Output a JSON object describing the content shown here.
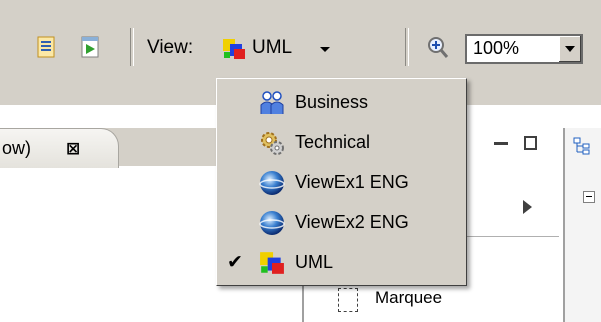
{
  "toolbar": {
    "view_label": "View:",
    "current_view": "UML",
    "zoom_value": "100%",
    "icons": [
      "report-icon",
      "run-icon",
      "uml-icon",
      "zoom-in-icon"
    ]
  },
  "editor": {
    "tab_label": "ow)",
    "tab_close_glyph": "⊠",
    "palette": {
      "marquee_label": "Marquee"
    }
  },
  "view_menu": {
    "items": [
      {
        "label": "Business",
        "icon": "business-people-icon",
        "checked": false
      },
      {
        "label": "Technical",
        "icon": "gears-icon",
        "checked": false
      },
      {
        "label": "ViewEx1 ENG",
        "icon": "sphere-icon",
        "checked": false
      },
      {
        "label": "ViewEx2 ENG",
        "icon": "sphere-icon",
        "checked": false
      },
      {
        "label": "UML",
        "icon": "uml-icon",
        "checked": true
      }
    ],
    "check_glyph": "✔"
  },
  "colors": {
    "toolbar_bg": "#d4d0c8",
    "menu_bg": "#d4d0c8",
    "accent_blue": "#2060c0"
  }
}
